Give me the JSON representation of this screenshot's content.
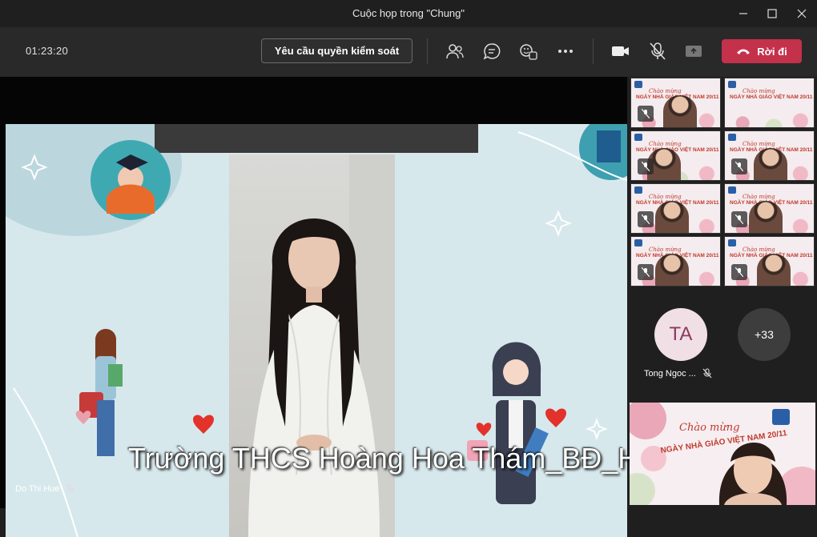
{
  "window": {
    "title": "Cuộc họp trong \"Chung\""
  },
  "toolbar": {
    "timer": "01:23:20",
    "request_control_label": "Yêu cầu quyền kiểm soát",
    "leave_label": "Rời đi",
    "icons": [
      "people-icon",
      "chat-icon",
      "reactions-icon",
      "more-icon",
      "camera-icon",
      "mic-off-icon",
      "share-tray-icon"
    ]
  },
  "stage": {
    "caption": "Trường THCS Hoàng Hoa Thám_BĐ_HN",
    "presenter_name": "Do Thi Hue"
  },
  "tiles": {
    "banner_line1": "Chào mừng",
    "banner_line2": "NGÀY NHÀ GIÁO VIỆT NAM 20/11"
  },
  "avatars": {
    "initials": "TA",
    "name": "Tong Ngoc ...",
    "overflow_count": "+33"
  },
  "colors": {
    "leave": "#c4314b",
    "toolbar": "#292929",
    "accent_red": "#c0392b"
  }
}
